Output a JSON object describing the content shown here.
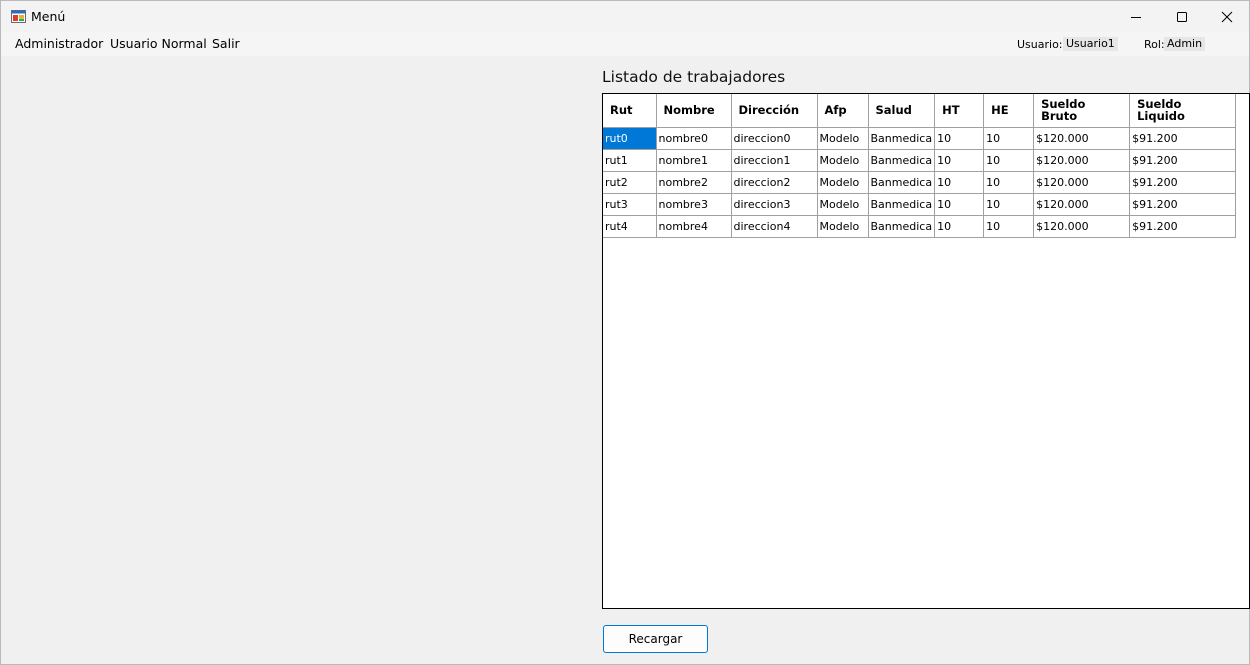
{
  "window": {
    "title": "Menú",
    "icon": "windows-form-icon"
  },
  "menu": {
    "items": [
      {
        "label": "Administrador"
      },
      {
        "label": "Usuario Normal"
      },
      {
        "label": "Salir"
      }
    ]
  },
  "status": {
    "user_label": "Usuario:",
    "user_value": "Usuario1",
    "role_label": "Rol:",
    "role_value": "Admin"
  },
  "list": {
    "title": "Listado de trabajadores",
    "columns": [
      "Rut",
      "Nombre",
      "Dirección",
      "Afp",
      "Salud",
      "HT",
      "HE",
      "Sueldo Bruto",
      "Sueldo Liquido"
    ],
    "rows": [
      [
        "rut0",
        "nombre0",
        "direccion0",
        "Modelo",
        "Banmedica",
        "10",
        "10",
        "$120.000",
        "$91.200"
      ],
      [
        "rut1",
        "nombre1",
        "direccion1",
        "Modelo",
        "Banmedica",
        "10",
        "10",
        "$120.000",
        "$91.200"
      ],
      [
        "rut2",
        "nombre2",
        "direccion2",
        "Modelo",
        "Banmedica",
        "10",
        "10",
        "$120.000",
        "$91.200"
      ],
      [
        "rut3",
        "nombre3",
        "direccion3",
        "Modelo",
        "Banmedica",
        "10",
        "10",
        "$120.000",
        "$91.200"
      ],
      [
        "rut4",
        "nombre4",
        "direccion4",
        "Modelo",
        "Banmedica",
        "10",
        "10",
        "$120.000",
        "$91.200"
      ]
    ]
  },
  "actions": {
    "reload_label": "Recargar"
  },
  "colors": {
    "selection": "#0078d7",
    "accent_border": "#0078d7"
  }
}
